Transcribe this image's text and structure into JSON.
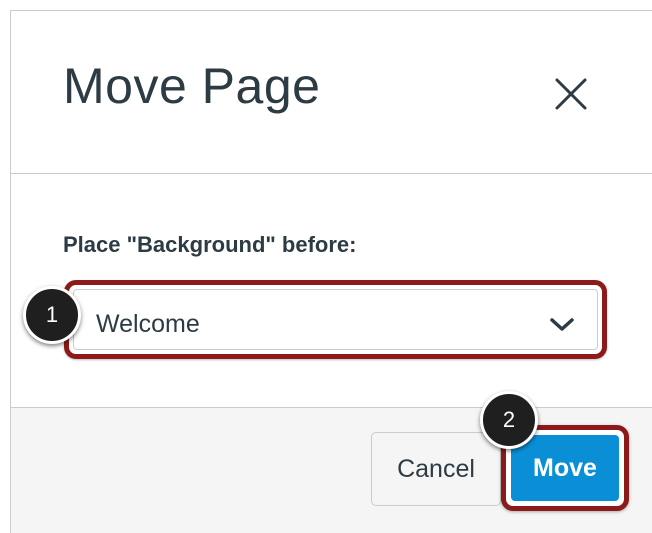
{
  "dialog": {
    "title": "Move Page",
    "close_icon": "close-icon"
  },
  "form": {
    "label": "Place \"Background\" before:",
    "select": {
      "selected_value": "Welcome",
      "chevron_icon": "chevron-down-icon"
    }
  },
  "footer": {
    "cancel_label": "Cancel",
    "move_label": "Move"
  },
  "annotations": {
    "step_1": "1",
    "step_2": "2"
  },
  "colors": {
    "text": "#2d3b45",
    "primary_button": "#0a8fd6",
    "highlight_outline": "#8b1a1a",
    "badge": "#1f1f1f",
    "footer_bg": "#f5f5f5",
    "border": "#c7cdd1"
  }
}
